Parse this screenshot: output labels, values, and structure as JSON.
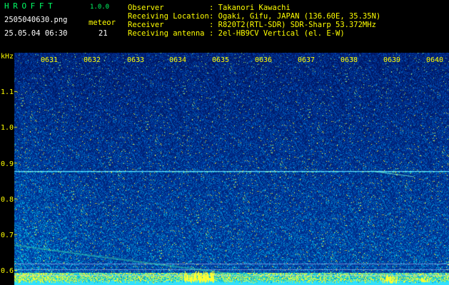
{
  "app": {
    "logo": "HROFFT",
    "version": "1.0.0",
    "filename": "2505040630.png",
    "meteor_label": "meteor",
    "meteor_count": "21",
    "datetime": "25.05.04 06:30"
  },
  "info": [
    {
      "label": "Observer",
      "value": ": Takanori Kawachi"
    },
    {
      "label": "Receiving Location",
      "value": ": Ogaki, Gifu, JAPAN (136.60E, 35.35N)"
    },
    {
      "label": "Receiver",
      "value": ": R820T2(RTL-SDR) SDR-Sharp 53.372MHz"
    },
    {
      "label": "Receiving antenna",
      "value": ": 2el-HB9CV Vertical (el. E-W)"
    }
  ],
  "axes": {
    "freq_unit": "kHz",
    "time_ticks": [
      "0631",
      "0632",
      "0633",
      "0634",
      "0635",
      "0636",
      "0637",
      "0638",
      "0639",
      "0640"
    ],
    "freq_ticks": [
      "1.1",
      "1.0",
      "0.9",
      "0.8",
      "0.7",
      "0.6"
    ]
  },
  "colors": {
    "background": "#000000",
    "label": "#ffff00",
    "title": "#00ff66",
    "spectrum_low": "#00206a",
    "spectrum_high": "#ffff00"
  }
}
